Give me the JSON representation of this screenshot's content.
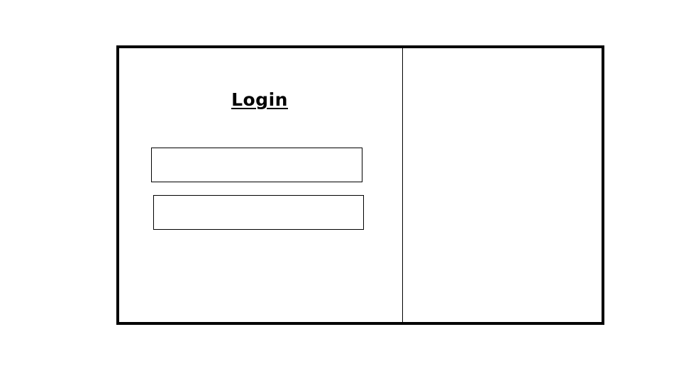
{
  "login_panel": {
    "title": "Login",
    "username_field": {
      "value": "",
      "placeholder": ""
    },
    "password_field": {
      "value": "",
      "placeholder": ""
    }
  },
  "colors": {
    "border": "#000000",
    "background": "#ffffff"
  }
}
